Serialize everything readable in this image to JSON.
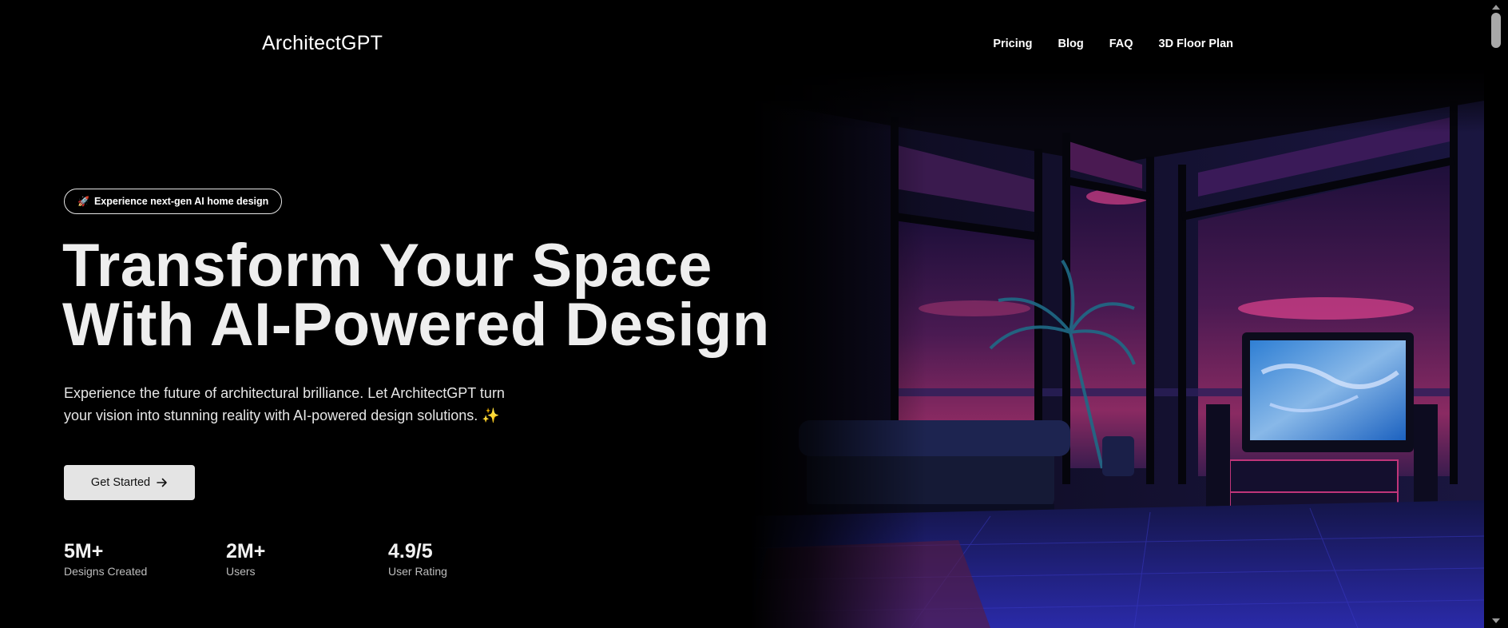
{
  "header": {
    "logo": "ArchitectGPT",
    "nav": [
      "Pricing",
      "Blog",
      "FAQ",
      "3D Floor Plan"
    ]
  },
  "hero": {
    "badge_icon": "rocket-icon",
    "badge": "Experience next-gen AI home design",
    "headline_line1": "Transform Your Space",
    "headline_line2": "With AI-Powered Design",
    "subtext_line1": "Experience the future of architectural brilliance. Let ArchitectGPT turn",
    "subtext_line2": "your vision into stunning reality with AI-powered design solutions.",
    "sparkle_icon": "sparkles-icon",
    "cta_label": "Get Started",
    "cta_icon": "arrow-right-icon",
    "image_subject": "living-room-neon-interior"
  },
  "stats": [
    {
      "value": "5M+",
      "label": "Designs Created"
    },
    {
      "value": "2M+",
      "label": "Users"
    },
    {
      "value": "4.9/5",
      "label": "User Rating"
    }
  ],
  "colors": {
    "background": "#000000",
    "text": "#ffffff",
    "cta_bg": "#e4e4e4",
    "accent_pink": "#c0357a",
    "accent_blue": "#2a7fc4"
  }
}
